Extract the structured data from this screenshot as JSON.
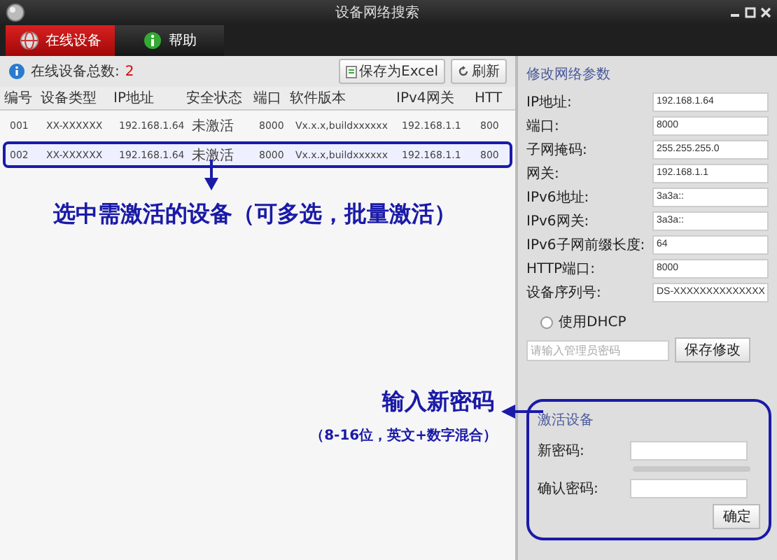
{
  "window": {
    "title": "设备网络搜索"
  },
  "tabs": [
    {
      "label": "在线设备",
      "selected": true
    },
    {
      "label": "帮助",
      "selected": false
    }
  ],
  "device_list": {
    "count_label": "在线设备总数:",
    "count": "2",
    "buttons": [
      "保存为Excel",
      "刷新"
    ],
    "columns": [
      "编号",
      "设备类型",
      "IP地址",
      "安全状态",
      "端口",
      "软件版本",
      "IPv4网关",
      "HTT"
    ],
    "rows": [
      {
        "selected": false,
        "cells": [
          "001",
          "XX-XXXXXX",
          "192.168.1.64",
          "未激活",
          "8000",
          "Vx.x.x,buildxxxxxx",
          "192.168.1.1",
          "800"
        ]
      },
      {
        "selected": true,
        "cells": [
          "002",
          "XX-XXXXXX",
          "192.168.1.64",
          "未激活",
          "8000",
          "Vx.x.x,buildxxxxxx",
          "192.168.1.1",
          "800"
        ]
      }
    ]
  },
  "network_params": {
    "title": "修改网络参数",
    "fields": [
      {
        "label": "IP地址:",
        "value": "192.168.1.64"
      },
      {
        "label": "端口:",
        "value": "8000"
      },
      {
        "label": "子网掩码:",
        "value": "255.255.255.0"
      },
      {
        "label": "网关:",
        "value": "192.168.1.1"
      },
      {
        "label": "IPv6地址:",
        "value": "3a3a::"
      },
      {
        "label": "IPv6网关:",
        "value": "3a3a::"
      },
      {
        "label": "IPv6子网前缀长度:",
        "value": "64"
      },
      {
        "label": "HTTP端口:",
        "value": "8000"
      },
      {
        "label": "设备序列号:",
        "value": "DS-XXXXXXXXXXXXXX"
      }
    ],
    "dhcp": {
      "label": "使用DHCP",
      "checked": false
    },
    "admin_password": {
      "placeholder": "请输入管理员密码"
    },
    "save_button": "保存修改"
  },
  "activation": {
    "title": "激活设备",
    "new_password": {
      "label": "新密码:"
    },
    "strength": {
      "level": 0
    },
    "confirm_password": {
      "label": "确认密码:"
    },
    "confirm_button": "确定"
  },
  "annotations": {
    "select_hint": "选中需激活的设备（可多选，批量激活）",
    "password_hint": "输入新密码",
    "password_rule": "（8-16位，英文+数字混合）"
  }
}
